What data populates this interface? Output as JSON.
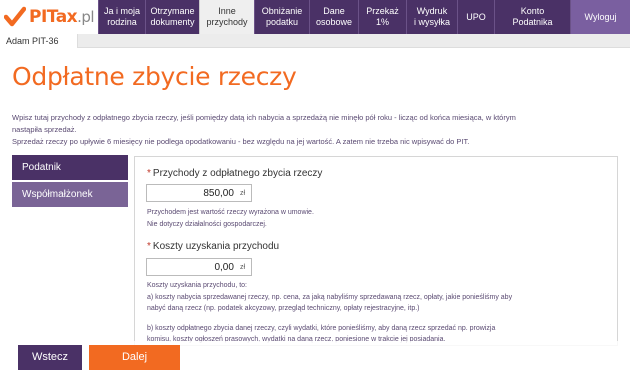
{
  "header": {
    "logo_text": "PITax",
    "logo_suffix": ".pl",
    "nav": [
      {
        "label": "Ja i moja\nrodzina"
      },
      {
        "label": "Otrzymane\ndokumenty"
      },
      {
        "label": "Inne\nprzychody"
      },
      {
        "label": "Obniżanie\npodatku"
      },
      {
        "label": "Dane\nosobowe"
      },
      {
        "label": "Przekaż\n1%"
      },
      {
        "label": "Wydruk\ni wysyłka"
      },
      {
        "label": "UPO"
      },
      {
        "label": "Konto\nPodatnika"
      },
      {
        "label": "Wyloguj"
      }
    ]
  },
  "subtab": "Adam PIT-36",
  "page_title": "Odpłatne zbycie rzeczy",
  "intro": {
    "line1": "Wpisz tutaj przychody z odpłatnego zbycia rzeczy, jeśli pomiędzy datą ich nabycia a sprzedażą nie minęło pół roku - licząc od końca miesiąca, w którym",
    "line2": "nastąpiła sprzedaż.",
    "line3": "Sprzedaż rzeczy po upływie 6 miesięcy nie podlega opodatkowaniu - bez względu na jej wartość. A zatem nie trzeba nic wpisywać do PIT."
  },
  "side_menu": [
    {
      "label": "Podatnik"
    },
    {
      "label": "Współmałżonek"
    }
  ],
  "form": {
    "field1": {
      "required_mark": "*",
      "label": "Przychody z odpłatnego zbycia rzeczy",
      "value": "850,00",
      "unit": "zł",
      "hint1": "Przychodem jest wartość rzeczy wyrażona w umowie.",
      "hint2": "Nie dotyczy działalności gospodarczej."
    },
    "field2": {
      "required_mark": "*",
      "label": "Koszty uzyskania przychodu",
      "value": "0,00",
      "unit": "zł",
      "hint1": "Koszty uzyskania przychodu, to:",
      "hint2": "a) koszty nabycia sprzedawanej rzeczy, np. cena, za jaką nabyliśmy sprzedawaną rzecz, opłaty, jakie ponieśliśmy aby",
      "hint3": "nabyć daną rzecz (np. podatek akcyzowy, przegląd techniczny, opłaty rejestracyjne, itp.)",
      "hint4": "b) koszty odpłatnego zbycia danej rzeczy, czyli wydatki, które ponieśliśmy, aby daną rzecz sprzedać np. prowizja",
      "hint5": "komisu, koszty ogłoszeń prasowych, wydatki na daną rzecz, poniesione w trakcie jej posiadania."
    }
  },
  "buttons": {
    "back": "Wstecz",
    "next": "Dalej"
  }
}
